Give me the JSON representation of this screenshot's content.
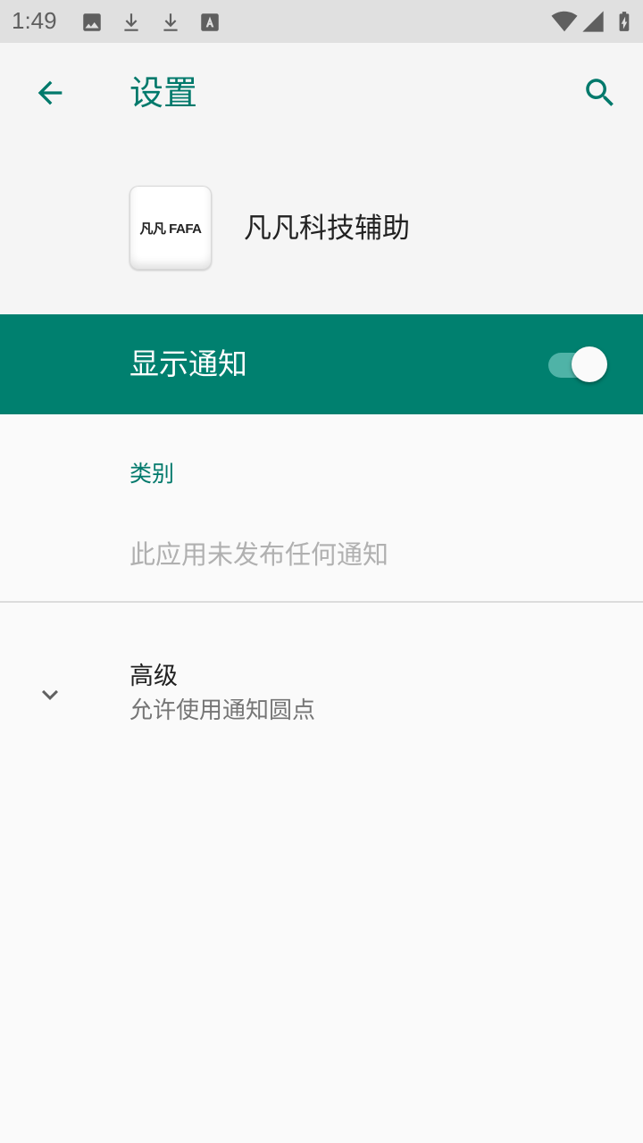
{
  "status_bar": {
    "time": "1:49",
    "icons": [
      "image-icon",
      "download-icon",
      "download-icon",
      "font-icon",
      "wifi-icon",
      "signal-icon",
      "battery-charging-icon"
    ]
  },
  "app_bar": {
    "title": "设置",
    "back_icon": "arrow-back-icon",
    "search_icon": "search-icon"
  },
  "app_header": {
    "icon_text": "凡凡 FAFA",
    "app_name": "凡凡科技辅助"
  },
  "master_switch": {
    "label": "显示通知",
    "checked": true
  },
  "category": {
    "header": "类别",
    "empty_text": "此应用未发布任何通知"
  },
  "advanced": {
    "title": "高级",
    "summary": "允许使用通知圆点",
    "icon": "chevron-down-icon"
  },
  "colors": {
    "accent": "#00796b",
    "switch_bar": "#00806f",
    "status_bar": "#e0e0e0",
    "background": "#fafafa"
  }
}
